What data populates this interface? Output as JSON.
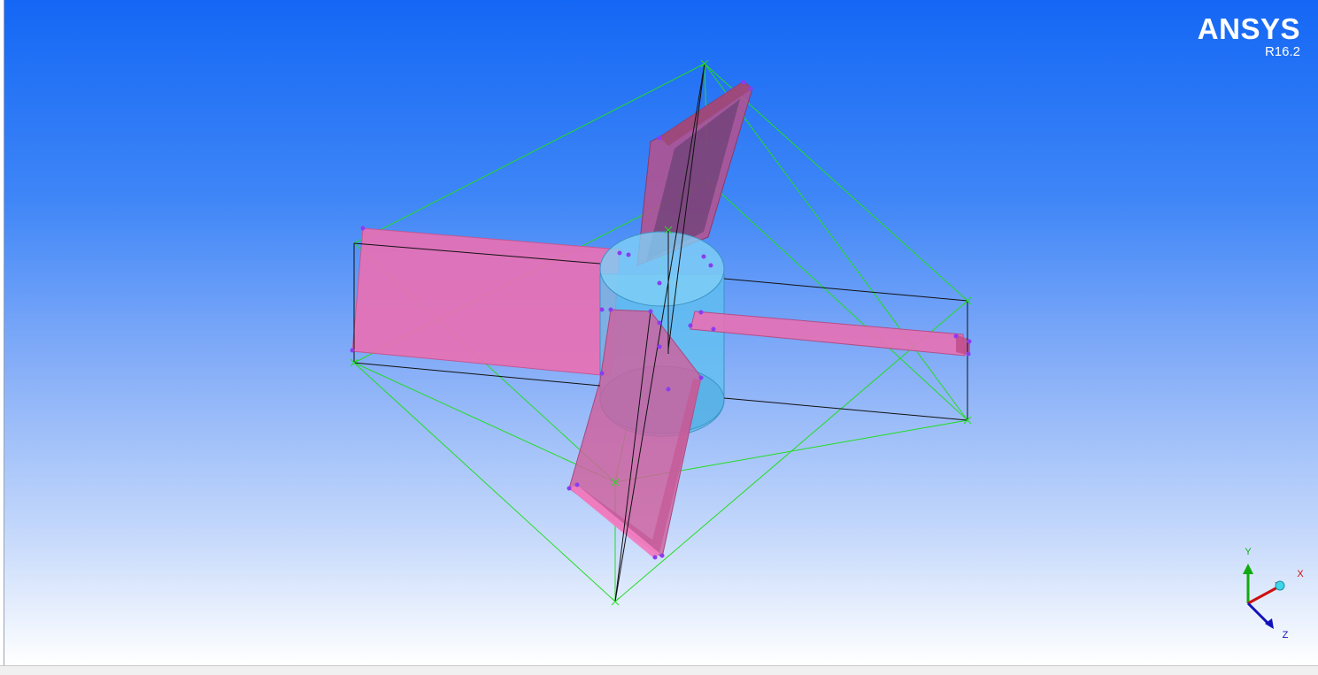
{
  "branding": {
    "product_name": "ANSYS",
    "version": "R16.2"
  },
  "triad": {
    "x_label": "X",
    "y_label": "Y",
    "z_label": "Z"
  },
  "colors": {
    "background_top": "#1467f5",
    "background_bottom": "#ffffff",
    "surface_body": "#e870b4",
    "cylinder_body": "#5fc2f0",
    "bounding_box": "#22dd22",
    "edges": "#111111",
    "vertex_points": "#8a3cf0",
    "x_axis": "#cc1111",
    "y_axis": "#11aa11",
    "z_axis": "#1111bb"
  }
}
